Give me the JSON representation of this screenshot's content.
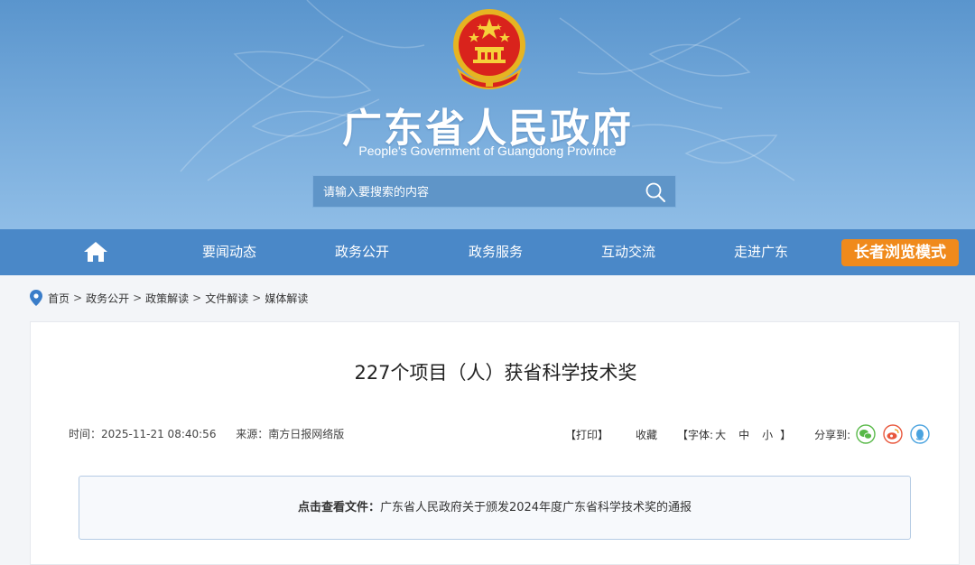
{
  "header": {
    "title": "广东省人民政府",
    "subtitle": "People's Government of Guangdong Province",
    "search_placeholder": "请输入要搜索的内容"
  },
  "nav": {
    "items": [
      "要闻动态",
      "政务公开",
      "政务服务",
      "互动交流",
      "走进广东"
    ],
    "elder_mode": "长者浏览模式"
  },
  "breadcrumb": [
    "首页",
    "政务公开",
    "政策解读",
    "文件解读",
    "媒体解读"
  ],
  "article": {
    "title": "227个项目（人）获省科学技术奖",
    "time": "时间：2025-11-21 08:40:56",
    "source": "来源：南方日报网络版",
    "print": "【打印】",
    "favorite": "收藏",
    "font_open": "【字体:",
    "font_large": "大",
    "font_medium": "中",
    "font_small": "小",
    "font_close": "】",
    "share": "分享到:",
    "notice_label": "点击查看文件：",
    "notice_link": "广东省人民政府关于颁发2024年度广东省科学技术奖的通报"
  },
  "colors": {
    "nav_bg": "#4a88c8",
    "elder_btn": "#f08a1c",
    "wechat": "#58b948",
    "weibo": "#e8563b",
    "qq": "#4aa3df"
  },
  "icons": [
    "national-emblem-icon",
    "search-icon",
    "home-icon",
    "location-pin-icon",
    "wechat-icon",
    "weibo-icon",
    "qq-icon"
  ]
}
